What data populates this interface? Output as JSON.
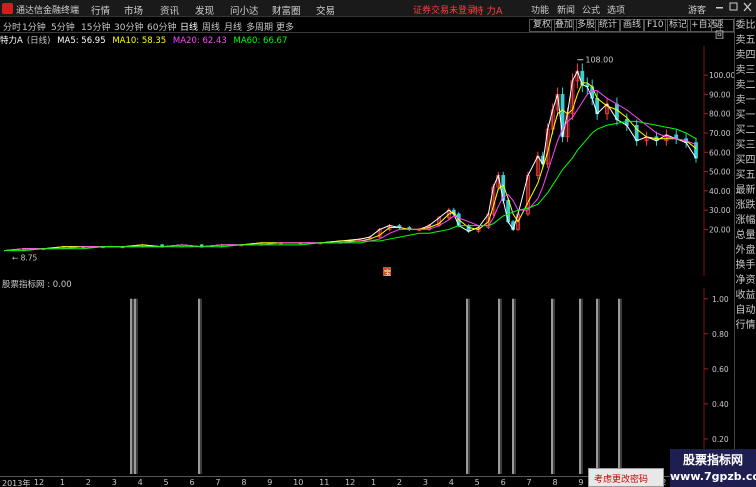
{
  "app": {
    "title": "通达信金融终端",
    "menu": [
      "行情",
      "市场",
      "资讯",
      "发现",
      "问小达",
      "财富圈",
      "交易"
    ],
    "login_text": "证券交易未登录",
    "stock_title": "特 力A",
    "right_menu": [
      "功能",
      "新闻",
      "公式",
      "选项",
      "游客"
    ]
  },
  "toolbar": {
    "periods": [
      "分时",
      "1分钟",
      "5分钟",
      "15分钟",
      "30分钟",
      "60分钟",
      "日线",
      "周线",
      "月线",
      "多周期",
      "更多"
    ],
    "active_period": "日线",
    "buttons": [
      "复权",
      "叠加",
      "多股",
      "统计",
      "画线",
      "F10",
      "标记",
      "+自选",
      "返回"
    ]
  },
  "info": {
    "name": "特力A",
    "period": "(日线)",
    "ma5": "MA5: 56.95",
    "ma10": "MA10: 58.35",
    "ma20": "MA20: 62.43",
    "ma60": "MA60: 66.67",
    "colors": {
      "ma5": "#ffffff",
      "ma10": "#ffff00",
      "ma20": "#ff44ff",
      "ma60": "#00ff00"
    }
  },
  "right_column": [
    "委比",
    "卖五",
    "卖四",
    "卖三",
    "卖二",
    "卖一",
    "买一",
    "买二",
    "买三",
    "买四",
    "买五",
    "最新",
    "涨跌",
    "涨幅",
    "总量",
    "外盘",
    "换手",
    "净资",
    "收益",
    "自动",
    "行情"
  ],
  "chart_data": [
    {
      "type": "line",
      "title": "特力A (日线)",
      "xlabel": "",
      "ylabel": "",
      "ylim": [
        0,
        112
      ],
      "yticks": [
        20.0,
        30.0,
        40.0,
        50.0,
        60.0,
        70.0,
        80.0,
        90.0,
        100.0
      ],
      "annotations": [
        "108.00",
        "8.75"
      ],
      "x": [
        0,
        20,
        40,
        60,
        80,
        100,
        120,
        140,
        160,
        180,
        200,
        220,
        240,
        260,
        280,
        300,
        320,
        340,
        360,
        370,
        380,
        390,
        400,
        410,
        420,
        430,
        440,
        450,
        455,
        460,
        470,
        480,
        490,
        495,
        500,
        505,
        510,
        515,
        520,
        530,
        540,
        545,
        550,
        555,
        560,
        565,
        570,
        575,
        580,
        585,
        590,
        595,
        600,
        610,
        620,
        630,
        640,
        650,
        660,
        670,
        680,
        690,
        700
      ],
      "series": [
        {
          "name": "",
          "values": [
            9,
            10,
            10,
            11,
            11,
            11,
            11,
            12,
            11,
            12,
            11,
            12,
            12,
            13,
            13,
            13,
            13,
            14,
            15,
            16,
            20,
            22,
            21,
            20,
            20,
            22,
            26,
            30,
            28,
            22,
            19,
            21,
            28,
            42,
            48,
            35,
            24,
            20,
            28,
            48,
            58,
            54,
            72,
            82,
            90,
            68,
            80,
            97,
            102,
            95,
            94,
            88,
            80,
            85,
            77,
            74,
            66,
            68,
            66,
            69,
            67,
            65,
            57
          ]
        },
        {
          "name": "",
          "values": [
            9,
            10,
            10,
            11,
            11,
            11,
            11,
            12,
            11,
            12,
            11,
            12,
            12,
            13,
            13,
            13,
            13,
            14,
            14,
            15,
            17,
            21,
            21,
            20,
            20,
            21,
            23,
            28,
            29,
            25,
            21,
            20,
            24,
            32,
            41,
            43,
            36,
            28,
            24,
            34,
            44,
            52,
            60,
            71,
            80,
            82,
            80,
            82,
            90,
            96,
            96,
            94,
            88,
            84,
            82,
            78,
            72,
            68,
            67,
            67,
            67,
            66,
            62
          ]
        },
        {
          "name": "",
          "values": [
            9,
            10,
            10,
            10,
            11,
            11,
            11,
            11,
            11,
            12,
            11,
            12,
            12,
            12,
            13,
            13,
            13,
            13,
            14,
            14,
            15,
            18,
            20,
            20,
            20,
            20,
            22,
            25,
            27,
            26,
            24,
            22,
            22,
            26,
            32,
            37,
            38,
            35,
            30,
            30,
            36,
            42,
            50,
            58,
            66,
            72,
            76,
            78,
            82,
            86,
            90,
            92,
            92,
            88,
            85,
            82,
            78,
            74,
            70,
            68,
            67,
            66,
            64
          ]
        },
        {
          "name": "",
          "values": [
            9,
            9,
            10,
            10,
            10,
            11,
            11,
            11,
            11,
            11,
            11,
            11,
            12,
            12,
            12,
            12,
            13,
            13,
            13,
            14,
            14,
            15,
            16,
            17,
            18,
            18,
            19,
            20,
            21,
            22,
            22,
            22,
            22,
            23,
            25,
            27,
            28,
            29,
            30,
            31,
            33,
            36,
            39,
            43,
            47,
            51,
            54,
            57,
            61,
            64,
            67,
            70,
            72,
            74,
            75,
            76,
            76,
            75,
            74,
            73,
            72,
            70,
            67
          ]
        }
      ]
    },
    {
      "type": "bar",
      "title": "股票指标网 : 0.00",
      "xlabel": "",
      "ylabel": "",
      "ylim": [
        0,
        1.05
      ],
      "yticks": [
        0.2,
        0.4,
        0.6,
        0.8,
        1.0
      ],
      "x": [
        131,
        135,
        199,
        467,
        499,
        513,
        552,
        580,
        597,
        619
      ],
      "values": [
        1,
        1,
        1,
        1,
        1,
        1,
        1,
        1,
        1,
        1
      ]
    }
  ],
  "date_axis": {
    "labels": [
      "2013年",
      "12",
      "1",
      "2",
      "3",
      "4",
      "5",
      "6",
      "7",
      "8",
      "9",
      "10",
      "11",
      "12",
      "1",
      "2",
      "3",
      "4",
      "5",
      "6",
      "7",
      "8",
      "9",
      "10",
      "11",
      "12",
      "1",
      "2"
    ]
  },
  "indicator": {
    "label": "股票指标网 : 0.00"
  },
  "main_marker": "宝",
  "popup": {
    "text": "考虑更改密码"
  },
  "watermark": {
    "title": "股票指标网",
    "url": "www.7gpzb.com"
  }
}
